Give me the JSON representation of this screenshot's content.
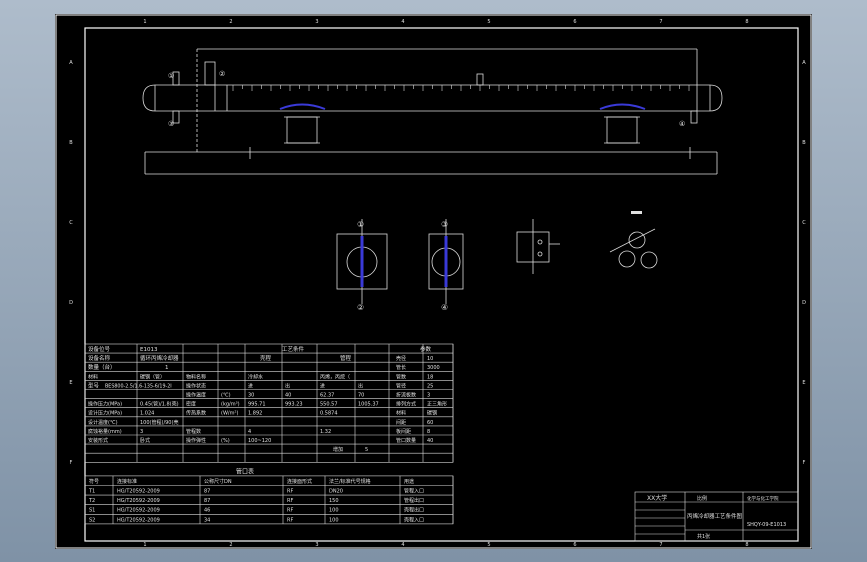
{
  "colors": {
    "background": "#000000",
    "frame": "#ffffff",
    "line": "#dcdcdc",
    "accent": "#3a3ad8",
    "dim": "#e0e0e0"
  },
  "nozzle_marks": {
    "n1": "①",
    "n2": "②",
    "n3": "③",
    "n4": "④",
    "n5": "⑤",
    "n6": "⑥"
  },
  "border_letters": [
    "A",
    "B",
    "C",
    "D",
    "E",
    "F"
  ],
  "border_numbers": [
    "1",
    "2",
    "3",
    "4",
    "5",
    "6",
    "7",
    "8"
  ],
  "datasheet": {
    "device_no_label": "设备位号",
    "device_no": "E1013",
    "device_name_label": "设备名称",
    "device_name": "循环丙烯冷却器",
    "qty_label": "数量（台）",
    "qty": "1",
    "process_cond": "工艺条件",
    "param_col": "参数",
    "shell_side": "壳程",
    "tube_side": "管程",
    "model_label": "型号",
    "model": "BES800-2.5/1.6-135-6/19-2Ⅰ",
    "rows": [
      [
        "材料",
        "碳钢（管）",
        "物料名称",
        "",
        "冷却水",
        "",
        "丙烯，丙烷（",
        "",
        "",
        ""
      ],
      [
        "",
        "",
        "操作状态",
        "",
        "进",
        "出",
        "进",
        "出",
        "",
        ""
      ],
      [
        "",
        "",
        "操作温度",
        "(℃)",
        "30",
        "40",
        "62.37",
        "70",
        "",
        ""
      ],
      [
        "操作压力(MPa)",
        "0.45(管)/1.8(壳)",
        "密度",
        "(kg/m³)",
        "995.71",
        "993.23",
        "550.57",
        "1005.37",
        "",
        ""
      ],
      [
        "设计压力(MPa)",
        "1.024",
        "传热系数",
        "(W/m²)",
        "1.892",
        "",
        "0.5874",
        "",
        "",
        ""
      ],
      [
        "设计温度(℃)",
        "100(管程)/90(壳",
        "",
        "",
        "",
        "",
        "",
        "",
        "",
        ""
      ],
      [
        "腐蚀裕量(mm)",
        "3",
        "管程数",
        "",
        "4",
        "",
        "1.32",
        "",
        "",
        ""
      ],
      [
        "安装形式",
        "卧式",
        "操作弹性",
        "(%)",
        "100~120",
        "",
        "",
        "",
        "",
        ""
      ]
    ],
    "right_labels": [
      "壳径",
      "管长",
      "管数",
      "管径",
      "折流板数",
      "排列方式",
      "材料",
      "间距",
      "板间距",
      "管口数量"
    ],
    "right_values": [
      "10",
      "3000",
      "18",
      "25",
      "3",
      "正三角形",
      "碳钢",
      "60",
      "8",
      "40"
    ],
    "extra": "增加",
    "extra_val": "5"
  },
  "nozzle_table": {
    "title": "管口表",
    "headers": [
      "符号",
      "连接标准",
      "公称尺寸DN",
      "连接面形式",
      "法兰/标准代号规格",
      "用途"
    ],
    "rows": [
      [
        "T1",
        "HG/T20592-2009",
        "87",
        "RF",
        "DN20",
        "管程入口"
      ],
      [
        "T2",
        "HG/T20592-2009",
        "87",
        "RF",
        "150",
        "管程出口"
      ],
      [
        "S1",
        "HG/T20592-2009",
        "46",
        "RF",
        "100",
        "壳程出口"
      ],
      [
        "S2",
        "HG/T20592-2009",
        "34",
        "RF",
        "100",
        "壳程入口"
      ]
    ]
  },
  "title_block": {
    "university": "XX大学",
    "school": "化学与化工学院",
    "drawing_title": "丙烯冷却器工艺条件图",
    "scale": "比例",
    "sheet": "共1张",
    "drawing_no": "SHQY-09-E1013"
  }
}
